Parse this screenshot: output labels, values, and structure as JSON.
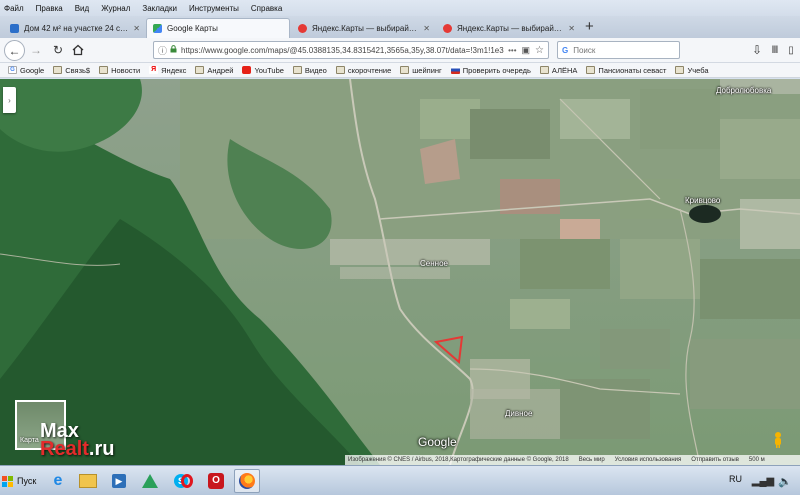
{
  "menu": [
    "Файл",
    "Правка",
    "Вид",
    "Журнал",
    "Закладки",
    "Инструменты",
    "Справка"
  ],
  "tabs": [
    {
      "label": "Дом 42 м² на участке 24 сот. - ...",
      "active": false,
      "icon_color": "#2c6fc9"
    },
    {
      "label": "Google Карты",
      "active": true,
      "icon_color": "#34a853"
    },
    {
      "label": "Яндекс.Карты — выбирайте, г...",
      "active": false,
      "icon_color": "#e53935"
    },
    {
      "label": "Яндекс.Карты — выбирайте, г...",
      "active": false,
      "icon_color": "#e53935"
    }
  ],
  "new_tab_label": "+",
  "nav": {
    "url": "https://www.google.com/maps/@45.0388135,34.8315421,3565a,35y,38.07t/data=!3m1!1e3",
    "search_placeholder": "Поиск"
  },
  "bookmarks": [
    {
      "label": "Google",
      "icon": "google-icon"
    },
    {
      "label": "Связь$",
      "icon": "folder-icon"
    },
    {
      "label": "Новости",
      "icon": "folder-icon"
    },
    {
      "label": "Яндекс",
      "icon": "yandex-icon"
    },
    {
      "label": "Андрей",
      "icon": "folder-icon"
    },
    {
      "label": "YouTube",
      "icon": "youtube-icon"
    },
    {
      "label": "Видео",
      "icon": "folder-icon"
    },
    {
      "label": "скорочтение",
      "icon": "folder-icon"
    },
    {
      "label": "шейпинг",
      "icon": "folder-icon"
    },
    {
      "label": "Проверить очередь",
      "icon": "flag-icon"
    },
    {
      "label": "АЛЁНА",
      "icon": "folder-icon"
    },
    {
      "label": "Пансионаты севаст",
      "icon": "folder-icon"
    },
    {
      "label": "Учеба",
      "icon": "folder-icon"
    }
  ],
  "map": {
    "labels": {
      "dobrolyubovka": "Добролюбовка",
      "krivtsovo": "Кривцово",
      "sennoe": "Сенное",
      "divnoe": "Дивное"
    },
    "google_logo": "Google",
    "thumb_label": "Карта",
    "attribution": [
      "Изображения © CNES / Airbus, 2018,Картографические данные © Google, 2018",
      "Весь мир",
      "Условия использования",
      "Отправить отзыв",
      "500 м"
    ]
  },
  "watermark": {
    "line1": "Max",
    "line2a": "Realt",
    "line2b": ".ru"
  },
  "taskbar": {
    "start": "Пуск",
    "lang": "RU"
  }
}
